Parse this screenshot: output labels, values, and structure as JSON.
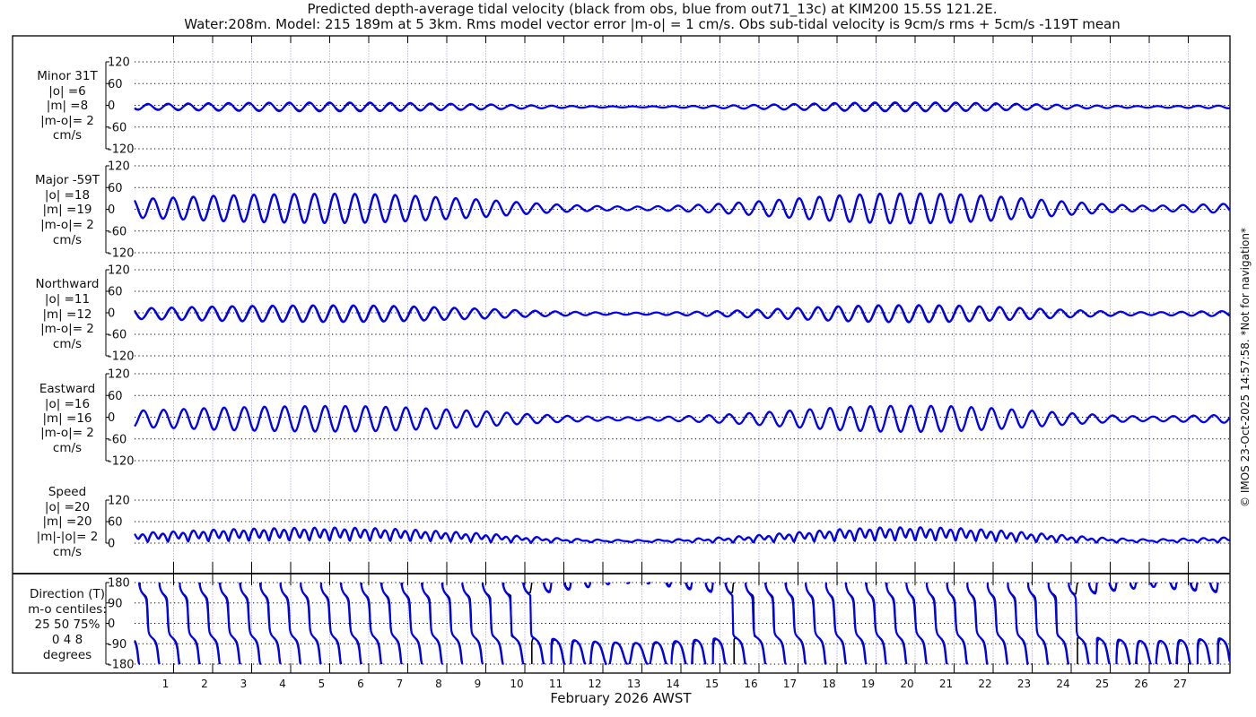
{
  "title": {
    "line1": "Predicted depth-average tidal velocity (black from obs, blue from out71_13c) at KIM200 15.5S 121.2E.",
    "line2": "Water:208m. Model: 215 189m at 5 3km. Rms model vector error |m-o| = 1 cm/s. Obs sub-tidal velocity is 9cm/s rms + 5cm/s -119T mean"
  },
  "side_note": "© IMOS 23-Oct-2025 14:57:58. *Not for navigation*",
  "colors": {
    "obs": "#000000",
    "model": "#0000ff",
    "grid": "#000000",
    "day_grid": "#c8c8ea"
  },
  "chart_data": {
    "type": "line",
    "xlabel": "February 2026 AWST",
    "x_ticks": [
      "1",
      "2",
      "3",
      "4",
      "5",
      "6",
      "7",
      "8",
      "9",
      "10",
      "11",
      "12",
      "13",
      "14",
      "15",
      "16",
      "17",
      "18",
      "19",
      "20",
      "21",
      "22",
      "23",
      "24",
      "25",
      "26",
      "27"
    ],
    "x_range_days": [
      0,
      28
    ],
    "grid": true,
    "series_legend": {
      "obs": "black from obs",
      "model": "blue from out71_13c"
    },
    "tidal_period_hours": 12.42,
    "mean_flow": {
      "speed_cm_s": 5,
      "direction_T": -119
    },
    "major_axis_T": -59,
    "minor_axis_T": 31,
    "major_daily_amplitude_model": [
      26,
      30,
      35,
      38,
      40,
      41,
      40,
      36,
      30,
      24,
      16,
      10,
      6,
      5,
      8,
      13,
      20,
      28,
      36,
      41,
      42,
      40,
      34,
      26,
      18,
      11,
      7,
      10,
      13
    ],
    "major_daily_amplitude_obs": [
      25,
      29,
      34,
      37,
      39,
      40,
      39,
      35,
      29,
      23,
      15,
      9,
      6,
      5,
      7,
      12,
      19,
      27,
      35,
      40,
      41,
      39,
      33,
      25,
      17,
      10,
      7,
      9,
      12
    ],
    "minor_to_major_ratio_model": 0.3,
    "minor_to_major_ratio_obs": 0.25,
    "panels": [
      {
        "id": "minor",
        "labels": [
          "Minor 31T",
          "|o| =6",
          "|m| =8",
          "|m-o|= 2",
          "cm/s"
        ],
        "yticks": [
          "120",
          "60",
          "0",
          "-60",
          "-120"
        ],
        "ylim": [
          -120,
          120
        ]
      },
      {
        "id": "major",
        "labels": [
          "Major -59T",
          "|o| =18",
          "|m| =19",
          "|m-o|= 2",
          "cm/s"
        ],
        "yticks": [
          "120",
          "60",
          "0",
          "-60",
          "-120"
        ],
        "ylim": [
          -120,
          120
        ]
      },
      {
        "id": "north",
        "labels": [
          "Northward",
          "|o| =11",
          "|m| =12",
          "|m-o|= 2",
          "cm/s"
        ],
        "yticks": [
          "120",
          "60",
          "0",
          "-60",
          "-120"
        ],
        "ylim": [
          -120,
          120
        ]
      },
      {
        "id": "east",
        "labels": [
          "Eastward",
          "|o| =16",
          "|m| =16",
          "|m-o|= 2",
          "cm/s"
        ],
        "yticks": [
          "120",
          "60",
          "0",
          "-60",
          "-120"
        ],
        "ylim": [
          -120,
          120
        ]
      },
      {
        "id": "speed",
        "labels": [
          "Speed",
          "|o| =20",
          "|m| =20",
          "|m|-|o|= 2",
          "cm/s"
        ],
        "yticks": [
          "120",
          "60",
          "0"
        ],
        "ylim": [
          0,
          120
        ]
      },
      {
        "id": "direction",
        "labels": [
          "Direction (T)",
          "m-o centiles:",
          "25  50  75%",
          "0  4  8",
          "degrees"
        ],
        "yticks": [
          "180",
          "90",
          "0",
          "-90",
          "-180"
        ],
        "ylim": [
          -180,
          180
        ]
      }
    ]
  }
}
